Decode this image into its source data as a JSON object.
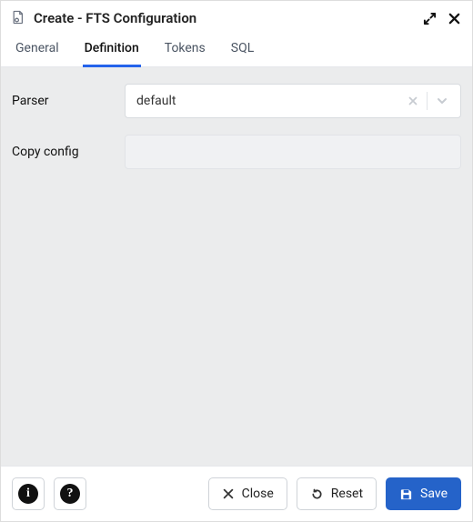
{
  "window": {
    "title": "Create - FTS Configuration"
  },
  "tabs": [
    {
      "id": "general",
      "label": "General",
      "active": false
    },
    {
      "id": "definition",
      "label": "Definition",
      "active": true
    },
    {
      "id": "tokens",
      "label": "Tokens",
      "active": false
    },
    {
      "id": "sql",
      "label": "SQL",
      "active": false
    }
  ],
  "form": {
    "parser": {
      "label": "Parser",
      "value": "default"
    },
    "copy_config": {
      "label": "Copy config",
      "value": ""
    }
  },
  "footer": {
    "info_glyph": "i",
    "help_glyph": "?",
    "close": "Close",
    "reset": "Reset",
    "save": "Save"
  },
  "colors": {
    "accent": "#2563c9",
    "panel_bg": "#ebeced",
    "border": "#e5e7eb"
  }
}
